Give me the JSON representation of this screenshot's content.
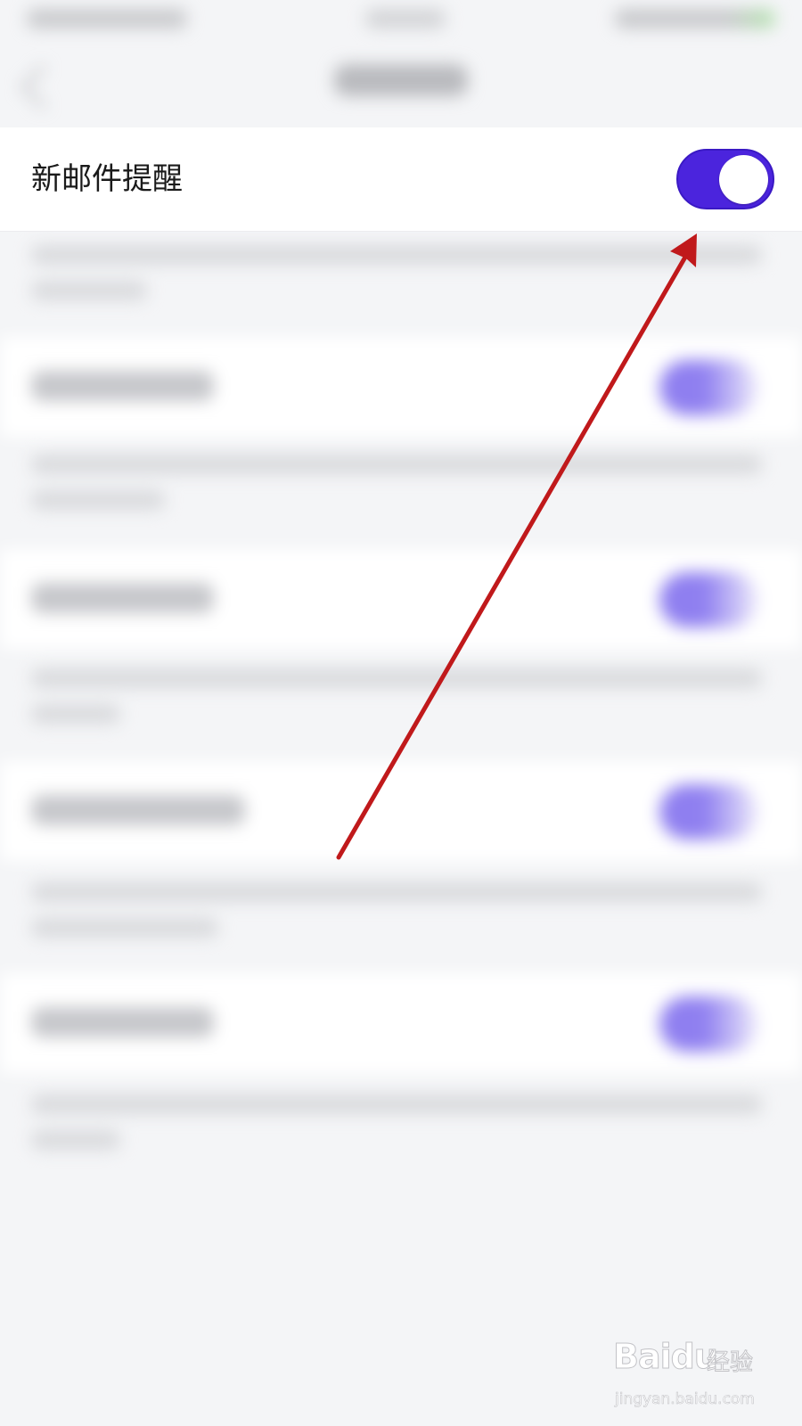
{
  "settings": {
    "new_mail_alert": {
      "label": "新邮件提醒",
      "enabled": true
    }
  },
  "colors": {
    "toggle_on": "#4b24dd",
    "annotation_arrow": "#c0191b",
    "background": "#f4f5f7"
  },
  "icons": {
    "annotation": "red-arrow-pointing-to-toggle"
  },
  "watermark": {
    "logo": "Baidu",
    "brand": "经验",
    "url": "jingyan.baidu.com"
  }
}
